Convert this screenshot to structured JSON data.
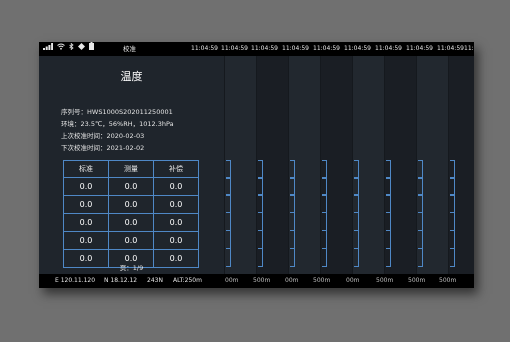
{
  "statusbar": {
    "title": "校准",
    "clocks": [
      "11:04:59",
      "11:04:59",
      "11:04:59",
      "11:04:59",
      "11:04:59",
      "11:04:59",
      "11:04:59",
      "11:04:59",
      "11:04:59",
      "11:04:59"
    ]
  },
  "panel": {
    "title": "温度",
    "serial": "序列号：HWS1000S202011250001",
    "environment": "环境：23.5℃，56%RH，1012.3hPa",
    "last_calibration": "上次校准时间：2020-02-03",
    "next_calibration": "下次校准时间：2021-02-02",
    "table": {
      "headers": [
        "标准",
        "测量",
        "补偿"
      ],
      "rows": [
        [
          "0.0",
          "0.0",
          "0.0"
        ],
        [
          "0.0",
          "0.0",
          "0.0"
        ],
        [
          "0.0",
          "0.0",
          "0.0"
        ],
        [
          "0.0",
          "0.0",
          "0.0"
        ],
        [
          "0.0",
          "0.0",
          "0.0"
        ]
      ]
    },
    "page_indicator": "页：1/9"
  },
  "bottombar": {
    "lon": "E 120.11.120",
    "lat": "N 18.12.12",
    "heading": "243N",
    "alt": "ALT:250m",
    "distances": [
      "00m",
      "500m",
      "00m",
      "500m",
      "00m",
      "500m",
      "500m",
      "500m"
    ]
  },
  "colors": {
    "background": "#707070",
    "screen": "#1d2127",
    "bars": "#000000",
    "grid_line": "#4f88c6"
  }
}
